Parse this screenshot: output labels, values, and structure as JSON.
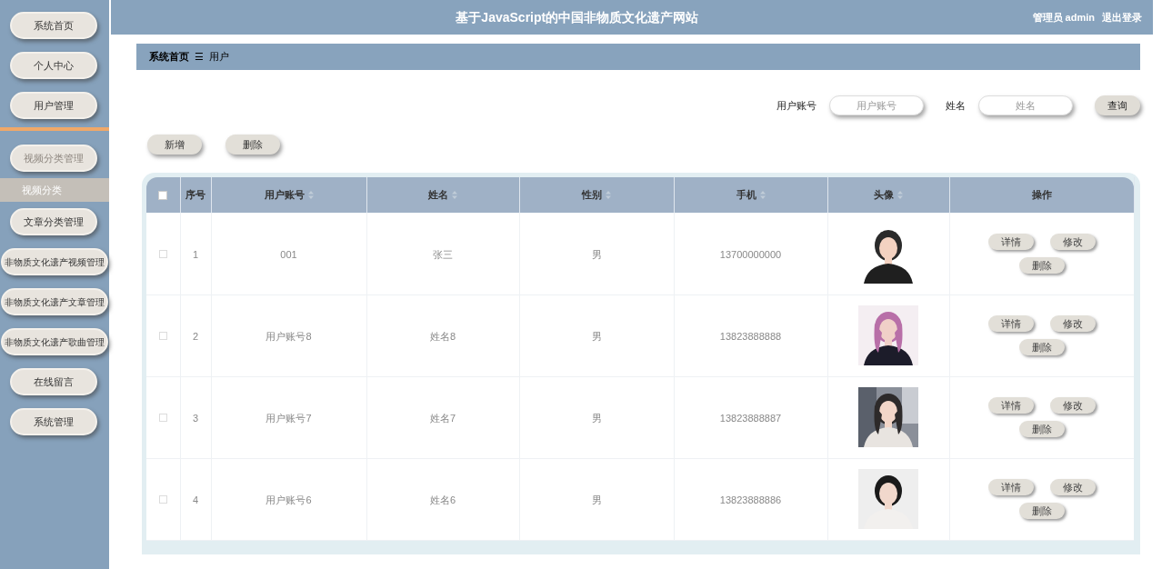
{
  "header": {
    "title": "基于JavaScript的中国非物质文化遗产网站",
    "user": "管理员 admin",
    "logout": "退出登录"
  },
  "sidebar": {
    "items": [
      {
        "label": "系统首页",
        "expanded": false
      },
      {
        "label": "个人中心",
        "expanded": false
      },
      {
        "label": "用户管理",
        "expanded": false
      },
      {
        "label": "视频分类管理",
        "expanded": true,
        "children": [
          {
            "label": "视频分类",
            "selected": true
          }
        ]
      },
      {
        "label": "文章分类管理",
        "expanded": false
      },
      {
        "label": "非物质文化遗产视频管理",
        "expanded": false
      },
      {
        "label": "非物质文化遗产文章管理",
        "expanded": false
      },
      {
        "label": "非物质文化遗产歌曲管理",
        "expanded": false
      },
      {
        "label": "在线留言",
        "expanded": false
      },
      {
        "label": "系统管理",
        "expanded": false
      }
    ]
  },
  "breadcrumb": {
    "home": "系统首页",
    "separator": "☰",
    "current": "用户"
  },
  "search": {
    "fields": [
      {
        "label": "用户账号",
        "placeholder": "用户账号"
      },
      {
        "label": "姓名",
        "placeholder": "姓名"
      }
    ],
    "button": "查询"
  },
  "actions": [
    "新增",
    "删除"
  ],
  "table": {
    "select_all": false,
    "columns": [
      {
        "label": "序号",
        "sortable": false
      },
      {
        "label": "用户账号",
        "sortable": true
      },
      {
        "label": "姓名",
        "sortable": true
      },
      {
        "label": "性别",
        "sortable": true
      },
      {
        "label": "手机",
        "sortable": true
      },
      {
        "label": "头像",
        "sortable": true
      },
      {
        "label": "操作",
        "sortable": false
      }
    ],
    "rows": [
      {
        "checked": false,
        "index": "1",
        "account": "001",
        "name": "张三",
        "gender": "男",
        "phone": "13700000000",
        "avatar": {
          "kind": "picture"
        },
        "buttons": [
          "详情",
          "修改",
          "删除"
        ]
      },
      {
        "checked": false,
        "index": "2",
        "account": "用户账号8",
        "name": "姓名8",
        "gender": "男",
        "phone": "13823888888",
        "avatar": {
          "kind": "picture"
        },
        "buttons": [
          "详情",
          "修改",
          "删除"
        ]
      },
      {
        "checked": false,
        "index": "3",
        "account": "用户账号7",
        "name": "姓名7",
        "gender": "男",
        "phone": "13823888887",
        "avatar": {
          "kind": "picture"
        },
        "buttons": [
          "详情",
          "修改",
          "删除"
        ]
      },
      {
        "checked": false,
        "index": "4",
        "account": "用户账号6",
        "name": "姓名6",
        "gender": "男",
        "phone": "13823888886",
        "avatar": {
          "kind": "picture"
        },
        "buttons": [
          "详情",
          "修改",
          "删除"
        ]
      }
    ]
  }
}
